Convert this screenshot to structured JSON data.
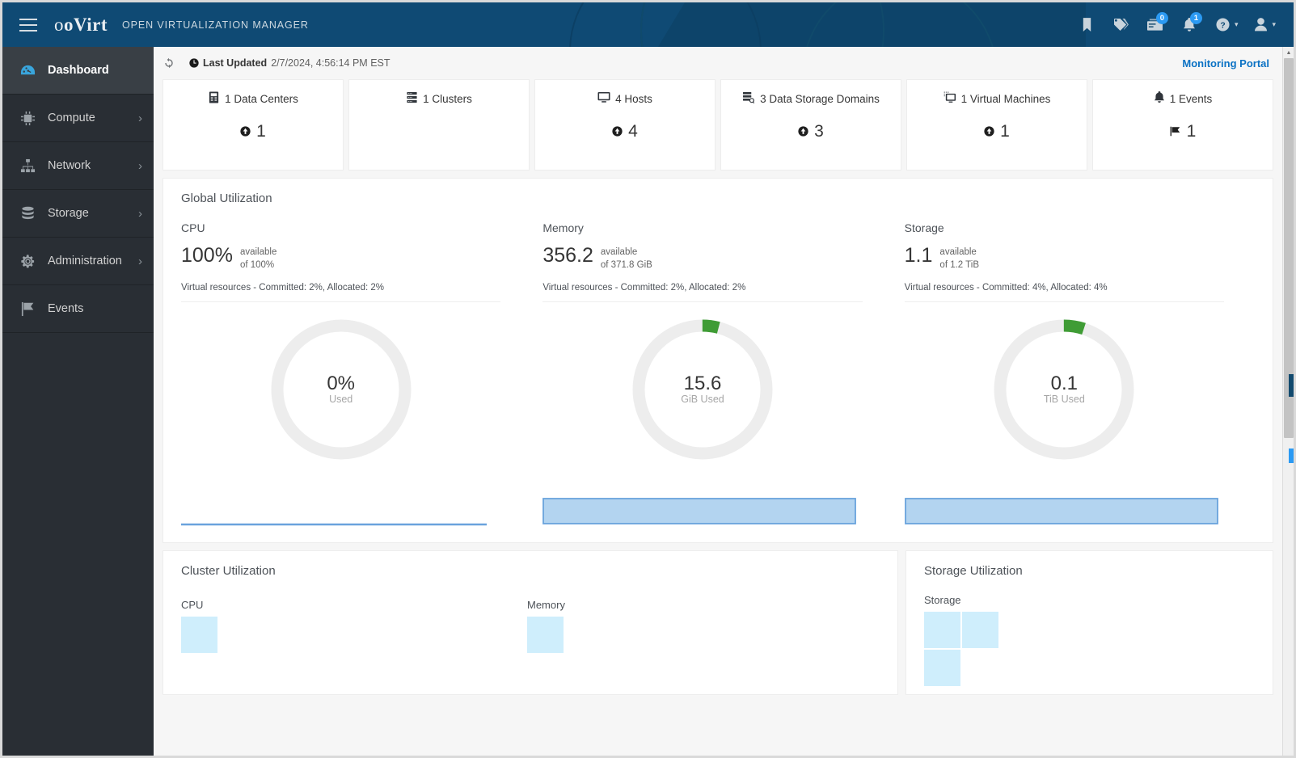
{
  "masthead": {
    "menu_icon": "hamburger-icon",
    "brand": "oVirt",
    "brand_subtitle": "OPEN VIRTUALIZATION MANAGER",
    "actions": [
      {
        "name": "bookmark-icon",
        "badge": null
      },
      {
        "name": "tag-icon",
        "badge": null
      },
      {
        "name": "tasks-icon",
        "badge": "0"
      },
      {
        "name": "bell-icon",
        "badge": "1"
      },
      {
        "name": "help-icon",
        "badge": null,
        "caret": true
      },
      {
        "name": "user-icon",
        "badge": null,
        "caret": true
      }
    ]
  },
  "sidebar": {
    "items": [
      {
        "label": "Dashboard",
        "icon": "dashboard-gauge-icon",
        "active": true,
        "chevron": false
      },
      {
        "label": "Compute",
        "icon": "cpu-chip-icon",
        "active": false,
        "chevron": true
      },
      {
        "label": "Network",
        "icon": "network-icon",
        "active": false,
        "chevron": true
      },
      {
        "label": "Storage",
        "icon": "database-icon",
        "active": false,
        "chevron": true
      },
      {
        "label": "Administration",
        "icon": "gear-icon",
        "active": false,
        "chevron": true
      },
      {
        "label": "Events",
        "icon": "flag-icon",
        "active": false,
        "chevron": false
      }
    ],
    "chevron_glyph": "›"
  },
  "toolbar": {
    "refresh_icon": "refresh-icon",
    "clock_icon": "clock-icon",
    "last_updated_label": "Last Updated",
    "last_updated_value": "2/7/2024, 4:56:14 PM EST",
    "monitoring_portal": "Monitoring Portal"
  },
  "kpi_cards": [
    {
      "title": "1 Data Centers",
      "icon": "datacenter-icon",
      "count": "1",
      "count_icon": "up-arrow-circle-icon"
    },
    {
      "title": "1 Clusters",
      "icon": "cluster-icon",
      "count": "",
      "count_icon": ""
    },
    {
      "title": "4 Hosts",
      "icon": "host-monitor-icon",
      "count": "4",
      "count_icon": "up-arrow-circle-icon"
    },
    {
      "title": "3 Data Storage Domains",
      "icon": "storage-domain-icon",
      "count": "3",
      "count_icon": "up-arrow-circle-icon"
    },
    {
      "title": "1 Virtual Machines",
      "icon": "vm-icon",
      "count": "1",
      "count_icon": "up-arrow-circle-icon"
    },
    {
      "title": "1 Events",
      "icon": "bell-icon",
      "count": "1",
      "count_icon": "flag-icon"
    }
  ],
  "global_utilization": {
    "title": "Global Utilization",
    "columns": [
      {
        "name": "CPU",
        "available_value": "100%",
        "available_label": "available",
        "available_of": "of 100%",
        "virtual_resources": "Virtual resources - Committed: 2%, Allocated: 2%",
        "donut_value": "0%",
        "donut_sub": "Used",
        "donut_used_percent": 0,
        "spark_type": "line",
        "spark_fill_percent": 0
      },
      {
        "name": "Memory",
        "available_value": "356.2",
        "available_label": "available",
        "available_of": "of 371.8 GiB",
        "virtual_resources": "Virtual resources - Committed: 2%, Allocated: 2%",
        "donut_value": "15.6",
        "donut_sub": "GiB Used",
        "donut_used_percent": 4,
        "spark_type": "area",
        "spark_fill_percent": 45
      },
      {
        "name": "Storage",
        "available_value": "1.1",
        "available_label": "available",
        "available_of": "of 1.2 TiB",
        "virtual_resources": "Virtual resources - Committed: 4%, Allocated: 4%",
        "donut_value": "0.1",
        "donut_sub": "TiB Used",
        "donut_used_percent": 5,
        "spark_type": "area",
        "spark_fill_percent": 48
      }
    ]
  },
  "cluster_utilization": {
    "title": "Cluster Utilization",
    "groups": [
      {
        "label": "CPU",
        "tiles": 1
      },
      {
        "label": "Memory",
        "tiles": 1
      }
    ]
  },
  "storage_utilization": {
    "title": "Storage Utilization",
    "groups": [
      {
        "label": "Storage",
        "tiles": 3
      }
    ]
  },
  "colors": {
    "masthead_blue": "#0f4a74",
    "accent_blue": "#0b72c4",
    "sidebar_bg": "#292e34",
    "sidebar_active": "#393f45",
    "donut_track": "#ededed",
    "donut_used": "#3f9c35",
    "heat_tile": "#cfeefc",
    "spark_fill": "#b3d4f0",
    "spark_stroke": "#6aa3dd"
  },
  "scrollbar": {
    "up_glyph": "▲",
    "down_glyph": "▼"
  }
}
